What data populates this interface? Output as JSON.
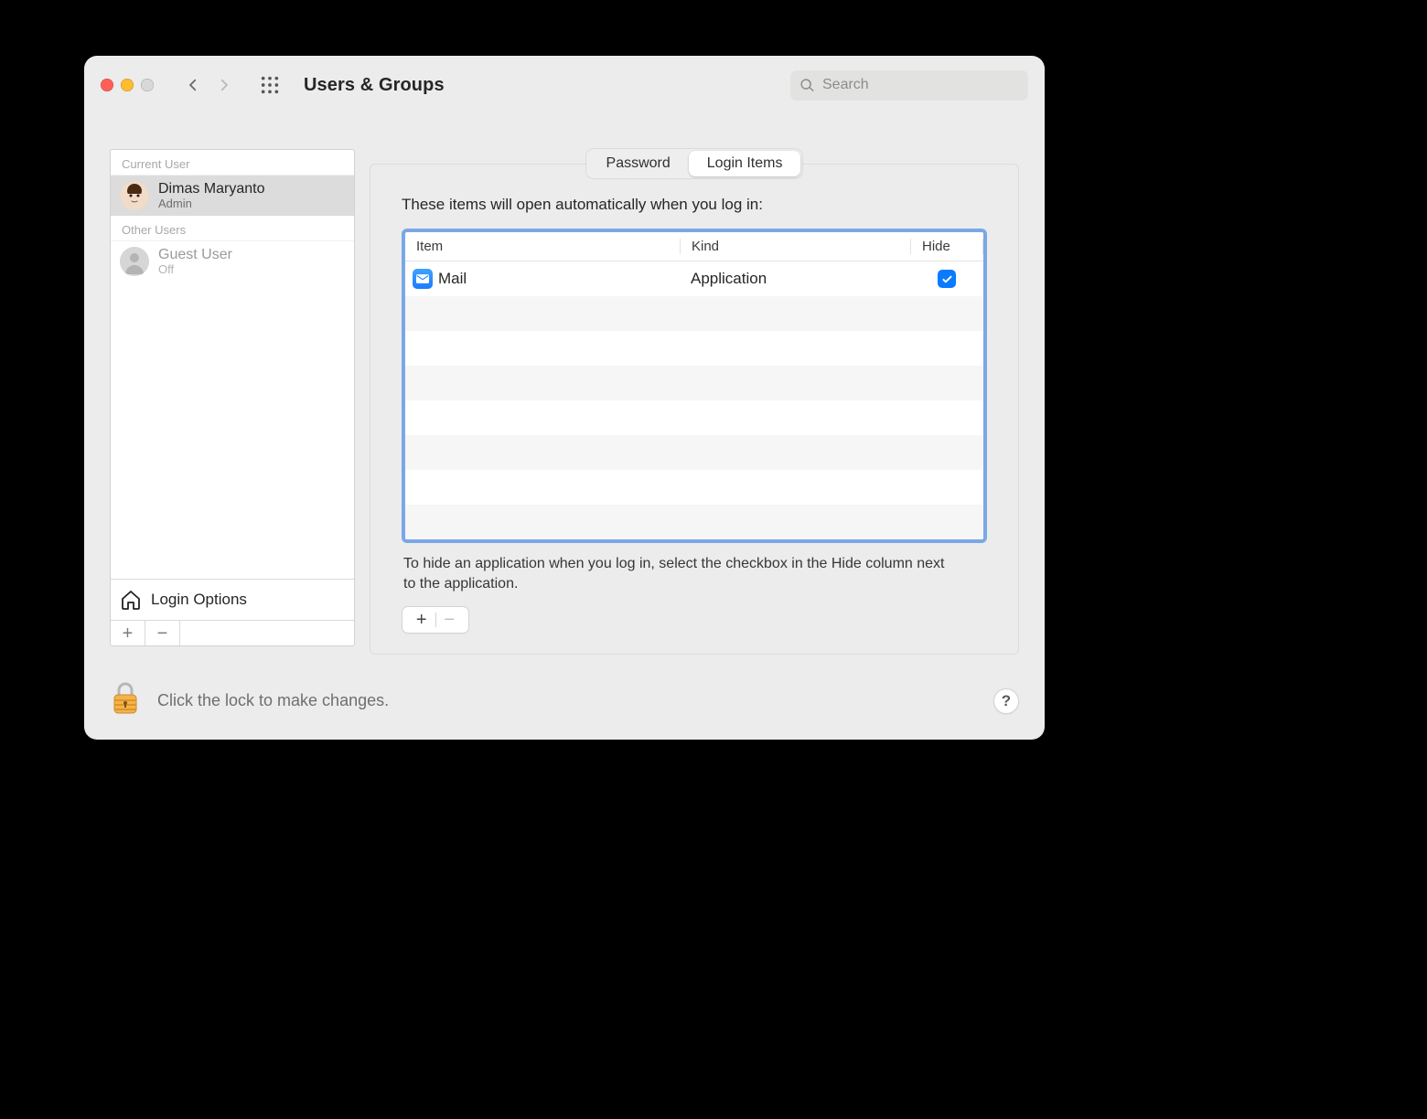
{
  "window": {
    "title": "Users & Groups",
    "search_placeholder": "Search"
  },
  "sidebar": {
    "sections": {
      "current_label": "Current User",
      "other_label": "Other Users"
    },
    "current_user": {
      "name": "Dimas Maryanto",
      "role": "Admin"
    },
    "other_users": [
      {
        "name": "Guest User",
        "status": "Off"
      }
    ],
    "login_options_label": "Login Options"
  },
  "tabs": {
    "password": "Password",
    "login_items": "Login Items",
    "active": "login_items"
  },
  "login_items": {
    "intro": "These items will open automatically when you log in:",
    "columns": {
      "item": "Item",
      "kind": "Kind",
      "hide": "Hide"
    },
    "rows": [
      {
        "icon": "mail-app",
        "name": "Mail",
        "kind": "Application",
        "hide": true
      }
    ],
    "hint": "To hide an application when you log in, select the checkbox in the Hide column next to the application."
  },
  "footer": {
    "lock_message": "Click the lock to make changes.",
    "help_label": "?"
  }
}
